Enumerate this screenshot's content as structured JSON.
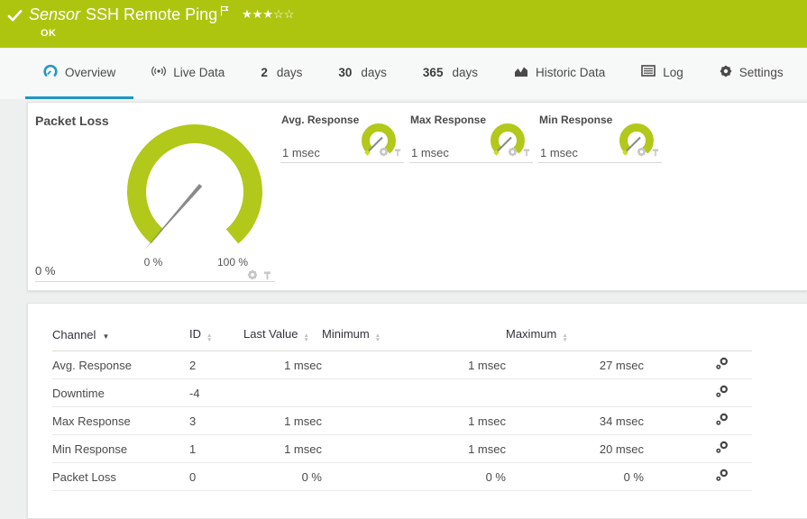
{
  "colors": {
    "status_green": "#aec510",
    "gauge_green": "#b2c81a",
    "accent_blue": "#2196c7",
    "marker_green": "#c9dd25"
  },
  "header": {
    "type_label": "Sensor",
    "title": "SSH Remote Ping",
    "status": "OK",
    "rating_filled": "★★★",
    "rating_empty": "☆☆"
  },
  "tabs": {
    "overview": "Overview",
    "live_data": "Live Data",
    "d2_num": "2",
    "d2_unit": "days",
    "d30_num": "30",
    "d30_unit": "days",
    "d365_num": "365",
    "d365_unit": "days",
    "historic": "Historic Data",
    "log": "Log",
    "settings": "Settings"
  },
  "gauges": {
    "main": {
      "title": "Packet Loss",
      "current_value": "0 %",
      "scale_min": "0 %",
      "scale_max": "100 %"
    },
    "small": [
      {
        "title": "Avg. Response",
        "value": "1 msec"
      },
      {
        "title": "Max Response",
        "value": "1 msec"
      },
      {
        "title": "Min Response",
        "value": "1 msec"
      }
    ]
  },
  "table": {
    "headers": {
      "channel": "Channel",
      "id": "ID",
      "last_value": "Last Value",
      "minimum": "Minimum",
      "maximum": "Maximum"
    },
    "rows": [
      {
        "channel": "Avg. Response",
        "id": "2",
        "last_value": "1 msec",
        "minimum": "1 msec",
        "maximum": "27 msec"
      },
      {
        "channel": "Downtime",
        "id": "-4",
        "last_value": "",
        "minimum": "",
        "maximum": ""
      },
      {
        "channel": "Max Response",
        "id": "3",
        "last_value": "1 msec",
        "minimum": "1 msec",
        "maximum": "34 msec"
      },
      {
        "channel": "Min Response",
        "id": "1",
        "last_value": "1 msec",
        "minimum": "1 msec",
        "maximum": "20 msec"
      },
      {
        "channel": "Packet Loss",
        "id": "0",
        "last_value": "0 %",
        "minimum": "0 %",
        "maximum": "0 %"
      }
    ]
  }
}
